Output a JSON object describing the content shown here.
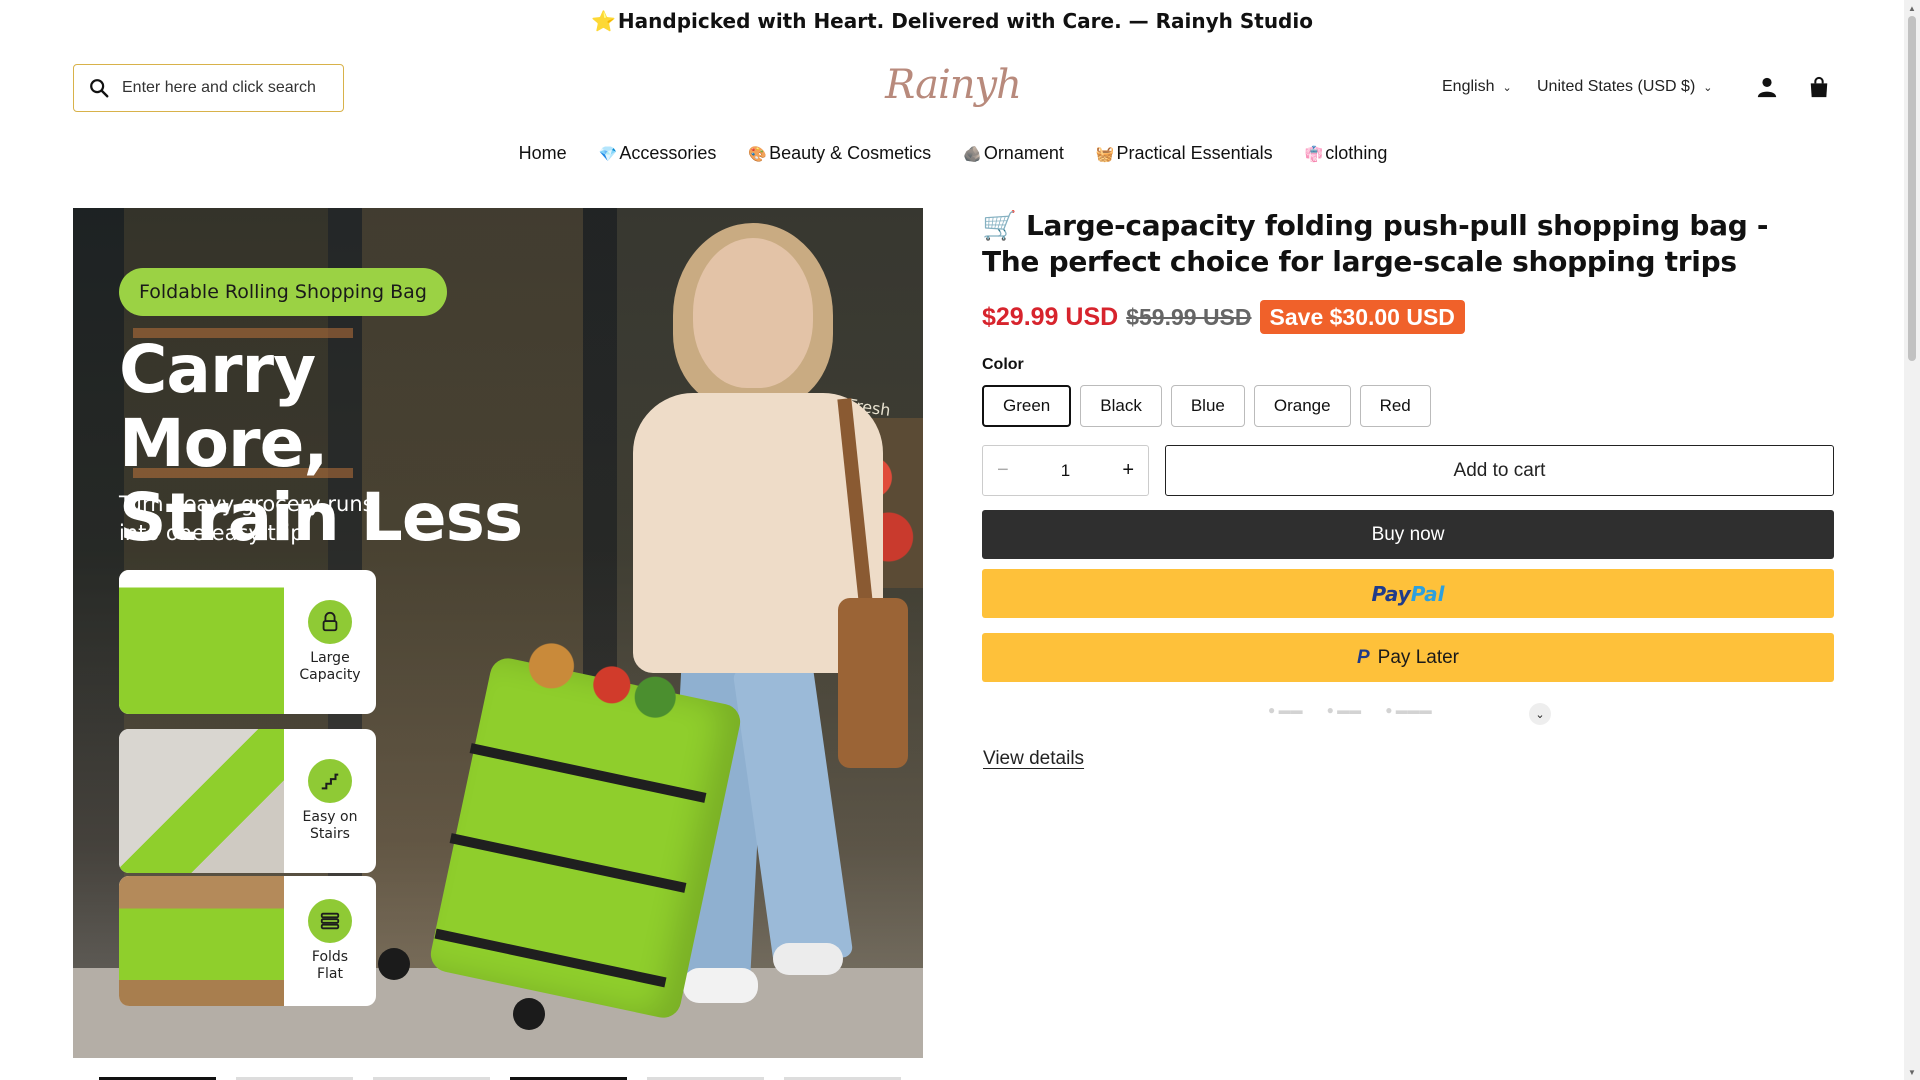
{
  "announcement": {
    "star": "⭐",
    "text": "Handpicked with Heart. Delivered with Care. — Rainyh Studio"
  },
  "header": {
    "search_placeholder": "Enter here and click search",
    "logo": "Rainyh",
    "language": "English",
    "currency": "United States (USD $)"
  },
  "nav": [
    {
      "emoji": "",
      "label": "Home"
    },
    {
      "emoji": "💎",
      "label": "Accessories"
    },
    {
      "emoji": "🎨",
      "label": "Beauty & Cosmetics"
    },
    {
      "emoji": "🪨",
      "label": "Ornament"
    },
    {
      "emoji": "🧺",
      "label": "Practical Essentials"
    },
    {
      "emoji": "👘",
      "label": "clothing"
    }
  ],
  "image": {
    "pill": "Foldable Rolling Shopping Bag",
    "headline_1": "Carry More,",
    "headline_2": "Strain Less",
    "subline_1": "Turn heavy grocery runs",
    "subline_2": "into one easy trip.",
    "store_sign": "Fresh",
    "features": [
      {
        "line1": "Large",
        "line2": "Capacity"
      },
      {
        "line1": "Easy on",
        "line2": "Stairs"
      },
      {
        "line1": "Folds",
        "line2": "Flat"
      }
    ]
  },
  "product": {
    "title": "🛒 Large-capacity folding push-pull shopping bag - The perfect choice for large-scale shopping trips",
    "price": "$29.99 USD",
    "compare_price": "$59.99 USD",
    "save": "Save $30.00 USD",
    "color_label": "Color",
    "colors": [
      "Green",
      "Black",
      "Blue",
      "Orange",
      "Red"
    ],
    "selected_color": "Green",
    "quantity": "1",
    "add_to_cart": "Add to cart",
    "buy_now": "Buy now",
    "paypal_1": "Pay",
    "paypal_2": "Pal",
    "pay_later": "Pay Later",
    "view_details": "View details"
  },
  "colors": {
    "accent_red": "#d7242d",
    "save_orange": "#f0612a",
    "paypal_yellow": "#fec13a",
    "bag_green": "#8fce2c"
  }
}
